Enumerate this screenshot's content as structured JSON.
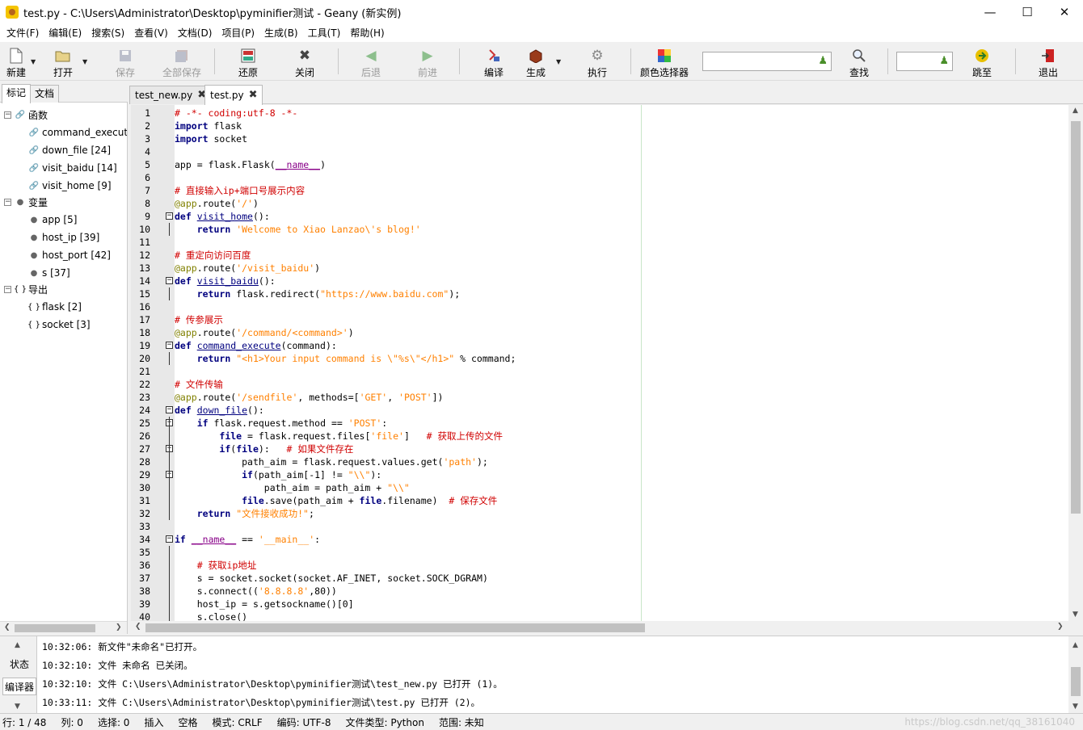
{
  "window": {
    "title": "test.py - C:\\Users\\Administrator\\Desktop\\pyminifier测试 - Geany (新实例)",
    "minimize": "—",
    "maximize": "☐",
    "close": "✕"
  },
  "menu": [
    "文件(F)",
    "编辑(E)",
    "搜索(S)",
    "查看(V)",
    "文档(D)",
    "项目(P)",
    "生成(B)",
    "工具(T)",
    "帮助(H)"
  ],
  "toolbar": {
    "new": "新建",
    "open": "打开",
    "save": "保存",
    "save_all": "全部保存",
    "revert": "还原",
    "close": "关闭",
    "back": "后退",
    "forward": "前进",
    "compile": "编译",
    "build": "生成",
    "execute": "执行",
    "color_picker": "颜色选择器",
    "search_value": "",
    "find": "查找",
    "goto_value": "",
    "goto": "跳至",
    "quit": "退出"
  },
  "sidebar": {
    "tabs": [
      "标记",
      "文档"
    ],
    "groups": {
      "functions": "函数",
      "variables": "变量",
      "imports": "导出"
    },
    "functions": [
      "command_execute",
      "down_file [24]",
      "visit_baidu [14]",
      "visit_home [9]"
    ],
    "variables": [
      "app [5]",
      "host_ip [39]",
      "host_port [42]",
      "s [37]"
    ],
    "imports": [
      "flask [2]",
      "socket [3]"
    ]
  },
  "editor": {
    "tabs": [
      {
        "label": "test_new.py",
        "active": false
      },
      {
        "label": "test.py",
        "active": true
      }
    ],
    "lines": [
      "# -*- coding:utf-8 -*-",
      "import flask",
      "import socket",
      "",
      "app = flask.Flask(__name__)",
      "",
      "# 直接输入ip+端口号展示内容",
      "@app.route('/')",
      "def visit_home():",
      "    return 'Welcome to Xiao Lanzao\\'s blog!'",
      "",
      "# 重定向访问百度",
      "@app.route('/visit_baidu')",
      "def visit_baidu():",
      "    return flask.redirect(\"https://www.baidu.com\");",
      "",
      "# 传参展示",
      "@app.route('/command/<command>')",
      "def command_execute(command):",
      "    return \"<h1>Your input command is \\\"%s\\\"</h1>\" % command;",
      "",
      "# 文件传输",
      "@app.route('/sendfile', methods=['GET', 'POST'])",
      "def down_file():",
      "    if flask.request.method == 'POST':",
      "        file = flask.request.files['file']   # 获取上传的文件",
      "        if(file):   # 如果文件存在",
      "            path_aim = flask.request.values.get('path');",
      "            if(path_aim[-1] != \"\\\\\"):",
      "                path_aim = path_aim + \"\\\\\"",
      "            file.save(path_aim + file.filename)  # 保存文件",
      "    return \"文件接收成功!\";",
      "",
      "if __name__ == '__main__':",
      "",
      "    # 获取ip地址",
      "    s = socket.socket(socket.AF_INET, socket.SOCK_DGRAM)",
      "    s.connect(('8.8.8.8',80))",
      "    host_ip = s.getsockname()[0]",
      "    s.close()"
    ],
    "line_numbers": [
      "1",
      "2",
      "3",
      "4",
      "5",
      "6",
      "7",
      "8",
      "9",
      "10",
      "11",
      "12",
      "13",
      "14",
      "15",
      "16",
      "17",
      "18",
      "19",
      "20",
      "21",
      "22",
      "23",
      "24",
      "25",
      "26",
      "27",
      "28",
      "29",
      "30",
      "31",
      "32",
      "33",
      "34",
      "35",
      "36",
      "37",
      "38",
      "39",
      "40"
    ]
  },
  "messages": {
    "tabs": [
      "状态",
      "编译器"
    ],
    "lines": [
      "10:32:06: 新文件\"未命名\"已打开。",
      "10:32:10: 文件 未命名 已关闭。",
      "10:32:10: 文件 C:\\Users\\Administrator\\Desktop\\pyminifier测试\\test_new.py 已打开 (1)。",
      "10:33:11: 文件 C:\\Users\\Administrator\\Desktop\\pyminifier测试\\test.py 已打开 (2)。"
    ]
  },
  "status": {
    "line": "行: 1 / 48",
    "col": "列: 0",
    "sel": "选择: 0",
    "ins": "插入",
    "indent": "空格",
    "mode": "模式: CRLF",
    "enc": "编码: UTF-8",
    "ftype": "文件类型: Python",
    "scope": "范围: 未知",
    "watermark": "https://blog.csdn.net/qq_38161040"
  }
}
